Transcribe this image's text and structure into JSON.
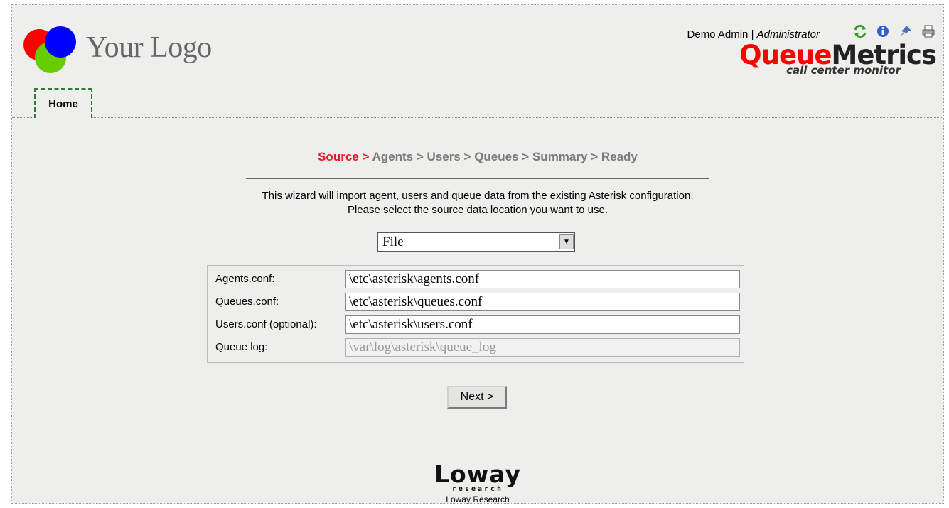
{
  "header": {
    "logo_text": "Your Logo",
    "user_name": "Demo Admin",
    "separator": "|",
    "user_role": "Administrator",
    "icons": [
      "refresh-icon",
      "info-icon",
      "pin-icon",
      "printer-icon"
    ],
    "brand_part1": "Queue",
    "brand_part2": "Metrics",
    "brand_sub": "call center monitor",
    "brand_color": "#ff0000"
  },
  "tabs": [
    {
      "label": "Home",
      "active": true
    }
  ],
  "wizard": {
    "steps": [
      "Source",
      "Agents",
      "Users",
      "Queues",
      "Summary",
      "Ready"
    ],
    "separator": ">",
    "active_step": "Source",
    "active_color": "#e8192c",
    "intro_line1": "This wizard will import agent, users and queue data from the existing Asterisk configuration.",
    "intro_line2": "Please select the source data location you want to use.",
    "source_select": {
      "value": "File"
    },
    "fields": [
      {
        "label": "Agents.conf:",
        "value": "\\etc\\asterisk\\agents.conf",
        "enabled": true
      },
      {
        "label": "Queues.conf:",
        "value": "\\etc\\asterisk\\queues.conf",
        "enabled": true
      },
      {
        "label": "Users.conf (optional):",
        "value": "\\etc\\asterisk\\users.conf",
        "enabled": true
      },
      {
        "label": "Queue log:",
        "value": "\\var\\log\\asterisk\\queue_log",
        "enabled": false
      }
    ],
    "next_label": "Next >"
  },
  "footer": {
    "logo_word": "Loway",
    "logo_sub": "research",
    "credit": "Loway Research"
  }
}
